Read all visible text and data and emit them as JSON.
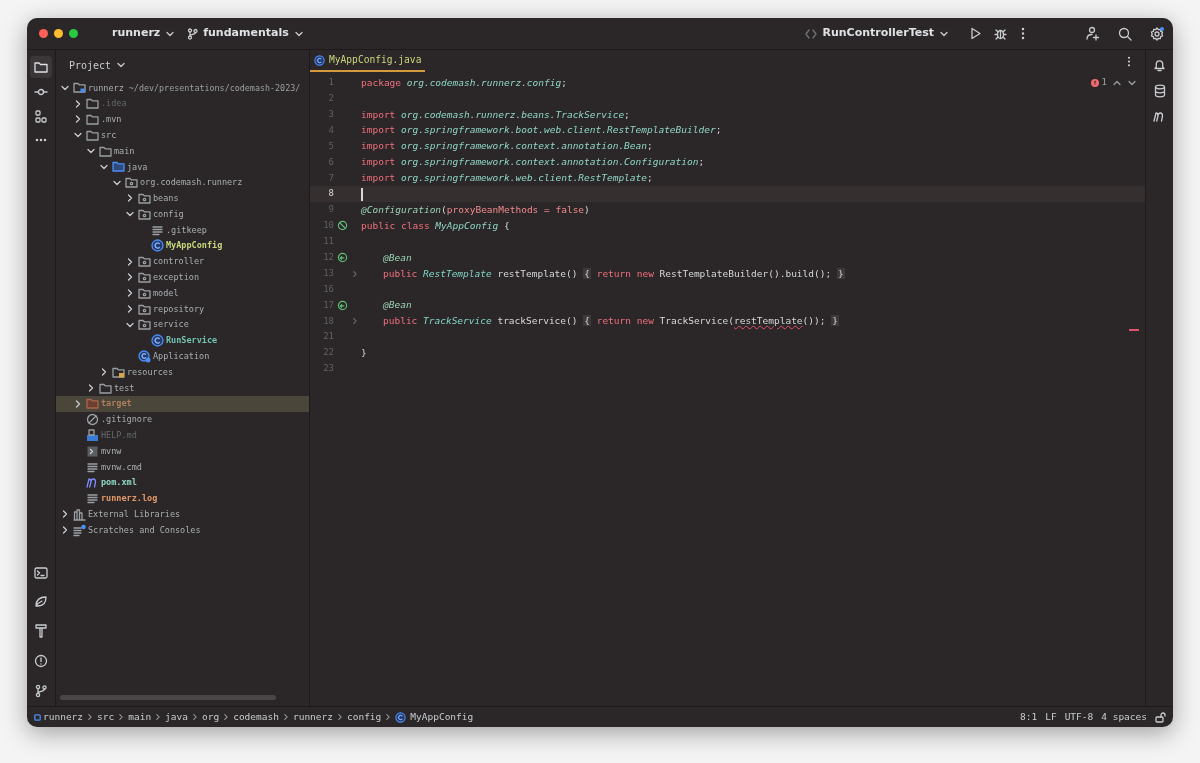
{
  "titlebar": {
    "project": "runnerz",
    "branch": "fundamentals",
    "run_config": "RunControllerTest"
  },
  "project_panel": {
    "title": "Project",
    "tree": [
      {
        "label": "runnerz",
        "path": "~/dev/presentations/codemash-2023/",
        "kind": "module",
        "expanded": true,
        "selected": false,
        "children": [
          {
            "label": ".idea",
            "kind": "folder",
            "color": "#62686a",
            "expanded": false,
            "selected": false
          },
          {
            "label": ".mvn",
            "kind": "folder",
            "expanded": false,
            "selected": false
          },
          {
            "label": "src",
            "kind": "folder",
            "expanded": true,
            "selected": false,
            "children": [
              {
                "label": "main",
                "kind": "folder",
                "expanded": true,
                "selected": false,
                "children": [
                  {
                    "label": "java",
                    "kind": "source",
                    "expanded": true,
                    "selected": false,
                    "children": [
                      {
                        "label": "org.codemash.runnerz",
                        "kind": "package",
                        "expanded": true,
                        "selected": false,
                        "children": [
                          {
                            "label": "beans",
                            "kind": "package",
                            "expanded": false,
                            "selected": false
                          },
                          {
                            "label": "config",
                            "kind": "package",
                            "expanded": true,
                            "selected": false,
                            "children": [
                              {
                                "label": ".gitkeep",
                                "kind": "text",
                                "selected": false
                              },
                              {
                                "label": "MyAppConfig",
                                "kind": "class",
                                "color": "#c8d77c",
                                "selected": false
                              }
                            ]
                          },
                          {
                            "label": "controller",
                            "kind": "package",
                            "expanded": false,
                            "selected": false
                          },
                          {
                            "label": "exception",
                            "kind": "package",
                            "expanded": false,
                            "selected": false
                          },
                          {
                            "label": "model",
                            "kind": "package",
                            "expanded": false,
                            "selected": false
                          },
                          {
                            "label": "repository",
                            "kind": "package",
                            "expanded": false,
                            "selected": false
                          },
                          {
                            "label": "service",
                            "kind": "package",
                            "expanded": true,
                            "selected": false,
                            "children": [
                              {
                                "label": "RunService",
                                "kind": "class",
                                "color": "#72c3b0",
                                "selected": false
                              }
                            ]
                          },
                          {
                            "label": "Application",
                            "kind": "app",
                            "selected": false
                          }
                        ]
                      }
                    ]
                  },
                  {
                    "label": "resources",
                    "kind": "resources",
                    "expanded": false,
                    "selected": false
                  }
                ]
              },
              {
                "label": "test",
                "kind": "folder",
                "expanded": false,
                "selected": false
              }
            ]
          },
          {
            "label": "target",
            "kind": "excluded",
            "expanded": false,
            "selected": true
          },
          {
            "label": ".gitignore",
            "kind": "ignore",
            "selected": false
          },
          {
            "label": "HELP.md",
            "kind": "markdown",
            "color": "#62686a",
            "selected": false
          },
          {
            "label": "mvnw",
            "kind": "shell",
            "selected": false
          },
          {
            "label": "mvnw.cmd",
            "kind": "text",
            "selected": false
          },
          {
            "label": "pom.xml",
            "kind": "maven",
            "color": "#8fd7c6",
            "selected": false
          },
          {
            "label": "runnerz.log",
            "kind": "text",
            "color": "#e59a68",
            "selected": false
          }
        ]
      },
      {
        "label": "External Libraries",
        "kind": "libraries",
        "expanded": false,
        "selected": false
      },
      {
        "label": "Scratches and Consoles",
        "kind": "scratches",
        "expanded": false,
        "selected": false
      }
    ]
  },
  "editor": {
    "tabs": [
      {
        "label": "MyAppConfig.java",
        "selected": true
      }
    ],
    "problems": "1",
    "lines": [
      {
        "number": "1",
        "tokens": [
          {
            "kind": "keyword",
            "text": "package "
          },
          {
            "kind": "package",
            "text": "org.codemash.runnerz.config"
          },
          {
            "kind": "plain",
            "text": ";"
          }
        ]
      },
      {
        "number": "2"
      },
      {
        "number": "3",
        "tokens": [
          {
            "kind": "keyword",
            "text": "import "
          },
          {
            "kind": "package",
            "text": "org.codemash.runnerz.beans.TrackService"
          },
          {
            "kind": "plain",
            "text": ";"
          }
        ]
      },
      {
        "number": "4",
        "tokens": [
          {
            "kind": "keyword",
            "text": "import "
          },
          {
            "kind": "package",
            "text": "org.springframework.boot.web.client.RestTemplateBuilder"
          },
          {
            "kind": "plain",
            "text": ";"
          }
        ]
      },
      {
        "number": "5",
        "tokens": [
          {
            "kind": "keyword",
            "text": "import "
          },
          {
            "kind": "package",
            "text": "org.springframework.context.annotation.Bean"
          },
          {
            "kind": "plain",
            "text": ";"
          }
        ]
      },
      {
        "number": "6",
        "tokens": [
          {
            "kind": "keyword",
            "text": "import "
          },
          {
            "kind": "package",
            "text": "org.springframework.context.annotation.Configuration"
          },
          {
            "kind": "plain",
            "text": ";"
          }
        ]
      },
      {
        "number": "7",
        "tokens": [
          {
            "kind": "keyword",
            "text": "import "
          },
          {
            "kind": "package",
            "text": "org.springframework.web.client.RestTemplate"
          },
          {
            "kind": "plain",
            "text": ";"
          }
        ]
      },
      {
        "number": "8",
        "current": true
      },
      {
        "number": "9",
        "tokens": [
          {
            "kind": "annotation",
            "text": "@Configuration"
          },
          {
            "kind": "plain",
            "text": "("
          },
          {
            "kind": "param",
            "text": "proxyBeanMethods = false"
          },
          {
            "kind": "plain",
            "text": ")"
          }
        ]
      },
      {
        "number": "10",
        "kind": "config",
        "tokens": [
          {
            "kind": "keyword",
            "text": "public class "
          },
          {
            "kind": "package",
            "text": "MyAppConfig"
          },
          {
            "kind": "plain",
            "text": " {"
          }
        ]
      },
      {
        "number": "11"
      },
      {
        "number": "12",
        "kind": "bean",
        "indented": true,
        "tokens": [
          {
            "kind": "annotation",
            "text": "@Bean"
          }
        ]
      },
      {
        "number": "13",
        "fold": true,
        "indented": true,
        "tokens": [
          {
            "kind": "keyword",
            "text": "public "
          },
          {
            "kind": "type",
            "text": "RestTemplate"
          },
          {
            "kind": "plain",
            "text": " restTemplate() "
          },
          {
            "kind": "folded",
            "text": "{"
          },
          {
            "kind": "keyword",
            "text": " return new"
          },
          {
            "kind": "plain",
            "text": " RestTemplateBuilder().build(); "
          },
          {
            "kind": "folded",
            "text": "}"
          }
        ]
      },
      {
        "number": "16"
      },
      {
        "number": "17",
        "kind": "bean",
        "indented": true,
        "tokens": [
          {
            "kind": "annotation",
            "text": "@Bean"
          }
        ]
      },
      {
        "number": "18",
        "fold": true,
        "indented": true,
        "tokens": [
          {
            "kind": "keyword",
            "text": "public "
          },
          {
            "kind": "type",
            "text": "TrackService"
          },
          {
            "kind": "plain",
            "text": " trackService() "
          },
          {
            "kind": "folded",
            "text": "{"
          },
          {
            "kind": "keyword",
            "text": " return new"
          },
          {
            "kind": "plain",
            "text": " TrackService("
          },
          {
            "kind": "error",
            "text": "restTemplate"
          },
          {
            "kind": "plain",
            "text": "()); "
          },
          {
            "kind": "folded",
            "text": "}"
          }
        ]
      },
      {
        "number": "21"
      },
      {
        "number": "22",
        "tokens": [
          {
            "kind": "plain",
            "text": "}"
          }
        ]
      },
      {
        "number": "23"
      }
    ]
  },
  "breadcrumbs": [
    {
      "label": "runnerz",
      "kind": "module"
    },
    {
      "label": "src"
    },
    {
      "label": "main"
    },
    {
      "label": "java"
    },
    {
      "label": "org"
    },
    {
      "label": "codemash"
    },
    {
      "label": "runnerz"
    },
    {
      "label": "config"
    },
    {
      "label": "MyAppConfig",
      "kind": "class"
    }
  ],
  "status": [
    "8:1",
    "LF",
    "UTF-8",
    "4 spaces"
  ]
}
